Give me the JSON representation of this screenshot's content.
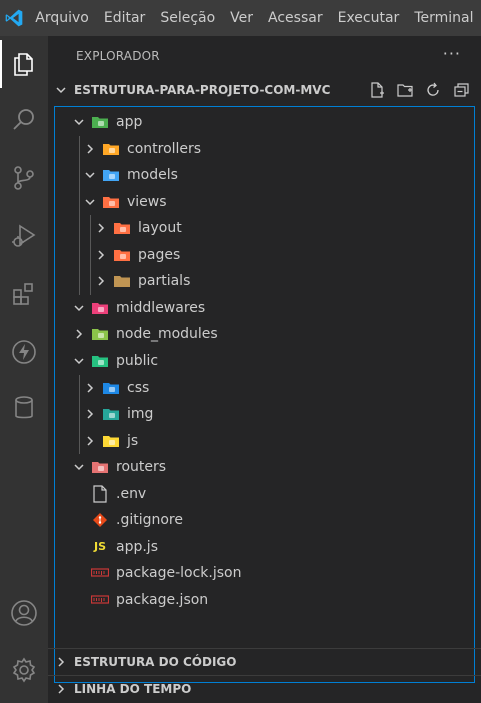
{
  "menu": [
    "Arquivo",
    "Editar",
    "Seleção",
    "Ver",
    "Acessar",
    "Executar",
    "Terminal"
  ],
  "explorer": {
    "title": "EXPLORADOR",
    "more": "···"
  },
  "project": {
    "name": "ESTRUTURA-PARA-PROJETO-COM-MVC",
    "actions": [
      "new-file-icon",
      "new-folder-icon",
      "refresh-icon",
      "collapse-all-icon"
    ]
  },
  "tree": [
    {
      "label": "app",
      "type": "folder",
      "depth": 0,
      "expanded": true,
      "icon": "folder-app-icon",
      "color": "#4caf50"
    },
    {
      "label": "controllers",
      "type": "folder",
      "depth": 1,
      "expanded": false,
      "icon": "folder-controllers-icon",
      "color": "#ffa726"
    },
    {
      "label": "models",
      "type": "folder",
      "depth": 1,
      "expanded": true,
      "icon": "folder-models-icon",
      "color": "#42a5f5"
    },
    {
      "label": "views",
      "type": "folder",
      "depth": 1,
      "expanded": true,
      "icon": "folder-views-icon",
      "color": "#ff7043"
    },
    {
      "label": "layout",
      "type": "folder",
      "depth": 2,
      "expanded": false,
      "icon": "folder-layout-icon",
      "color": "#ff7043"
    },
    {
      "label": "pages",
      "type": "folder",
      "depth": 2,
      "expanded": false,
      "icon": "folder-pages-icon",
      "color": "#ff7043"
    },
    {
      "label": "partials",
      "type": "folder",
      "depth": 2,
      "expanded": false,
      "icon": "folder-icon",
      "color": "#c09553"
    },
    {
      "label": "middlewares",
      "type": "folder",
      "depth": 0,
      "expanded": true,
      "icon": "folder-middlewares-icon",
      "color": "#ec407a"
    },
    {
      "label": "node_modules",
      "type": "folder",
      "depth": 0,
      "expanded": false,
      "icon": "folder-node-icon",
      "color": "#8bc34a"
    },
    {
      "label": "public",
      "type": "folder",
      "depth": 0,
      "expanded": true,
      "icon": "folder-public-icon",
      "color": "#26c281"
    },
    {
      "label": "css",
      "type": "folder",
      "depth": 1,
      "expanded": false,
      "icon": "folder-css-icon",
      "color": "#1e88e5"
    },
    {
      "label": "img",
      "type": "folder",
      "depth": 1,
      "expanded": false,
      "icon": "folder-images-icon",
      "color": "#26a69a"
    },
    {
      "label": "js",
      "type": "folder",
      "depth": 1,
      "expanded": false,
      "icon": "folder-js-icon",
      "color": "#fdd835"
    },
    {
      "label": "routers",
      "type": "folder",
      "depth": 0,
      "expanded": true,
      "icon": "folder-routes-icon",
      "color": "#e57373"
    },
    {
      "label": ".env",
      "type": "file",
      "depth": 0,
      "icon": "file-icon",
      "color": "#cccccc"
    },
    {
      "label": ".gitignore",
      "type": "file",
      "depth": 0,
      "icon": "git-icon",
      "color": "#e64a19"
    },
    {
      "label": "app.js",
      "type": "file",
      "depth": 0,
      "icon": "js-icon",
      "color": "#f1dd35",
      "badge": "JS"
    },
    {
      "label": "package-lock.json",
      "type": "file",
      "depth": 0,
      "icon": "npm-icon",
      "color": "#cb3837"
    },
    {
      "label": "package.json",
      "type": "file",
      "depth": 0,
      "icon": "npm-icon",
      "color": "#cb3837"
    }
  ],
  "sections": [
    {
      "label": "ESTRUTURA DO CÓDIGO"
    },
    {
      "label": "LINHA DO TEMPO"
    }
  ],
  "colors": {
    "accent": "#007fd4",
    "titlebar": "#3c3c3c",
    "activitybar": "#333333",
    "sidebar": "#252526"
  }
}
